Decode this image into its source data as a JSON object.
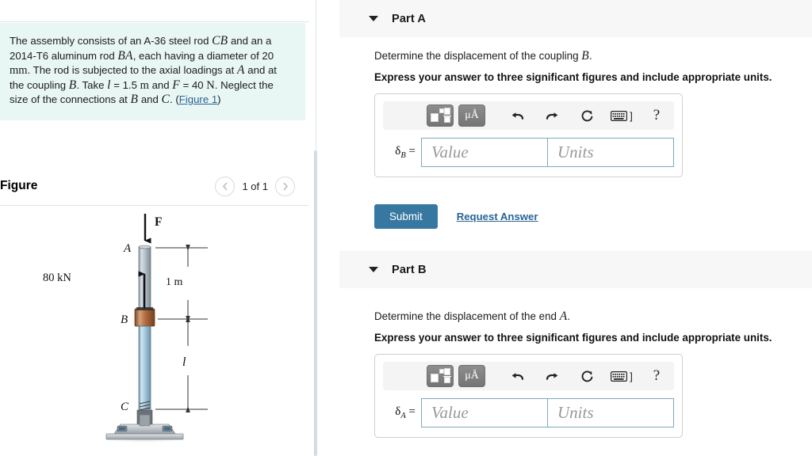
{
  "left": {
    "problem": {
      "segments": [
        {
          "t": "The assembly consists of an A-36 steel rod ",
          "s": "plain"
        },
        {
          "t": "CB",
          "s": "math"
        },
        {
          "t": " and an a 2014-T6 aluminum rod ",
          "s": "plain"
        },
        {
          "t": "BA",
          "s": "math"
        },
        {
          "t": ", each having a diameter of 20 ",
          "s": "plain"
        },
        {
          "t": "mm",
          "s": "mathup"
        },
        {
          "t": ". The rod is subjected to the axial loadings at ",
          "s": "plain"
        },
        {
          "t": "A",
          "s": "math"
        },
        {
          "t": " and at the coupling ",
          "s": "plain"
        },
        {
          "t": "B",
          "s": "math"
        },
        {
          "t": ". Take ",
          "s": "plain"
        },
        {
          "t": "l",
          "s": "math"
        },
        {
          "t": " = 1.5 ",
          "s": "plain"
        },
        {
          "t": "m",
          "s": "mathup"
        },
        {
          "t": " and ",
          "s": "plain"
        },
        {
          "t": "F",
          "s": "math"
        },
        {
          "t": " = 40 ",
          "s": "plain"
        },
        {
          "t": "N",
          "s": "mathup"
        },
        {
          "t": ". Neglect the size of the connections at ",
          "s": "plain"
        },
        {
          "t": "B",
          "s": "math"
        },
        {
          "t": " and ",
          "s": "plain"
        },
        {
          "t": "C",
          "s": "math"
        },
        {
          "t": ". (",
          "s": "plain"
        },
        {
          "t": "Figure 1",
          "s": "link"
        },
        {
          "t": ")",
          "s": "plain"
        }
      ],
      "background_color": "#e8f6f4"
    },
    "figure": {
      "title": "Figure",
      "prev_icon": "chevron-left-icon",
      "next_icon": "chevron-right-icon",
      "counter": "1 of 1",
      "labels": {
        "force": "F",
        "point_a": "A",
        "point_b": "B",
        "point_c": "C",
        "load": "80 kN",
        "dim_top": "1 m",
        "dim_bottom": "l"
      },
      "colors": {
        "aluminum_rod": "#b7c5ce",
        "steel_rod": "#a8cbdd",
        "coupling": "#b8764a",
        "base": "#c3c6c9"
      }
    }
  },
  "right": {
    "parts": [
      {
        "id": "part-a",
        "label": "Part A",
        "caret_icon": "caret-down-icon",
        "prompt_segments": [
          {
            "t": "Determine the displacement of the coupling ",
            "s": "plain"
          },
          {
            "t": "B",
            "s": "math"
          },
          {
            "t": ".",
            "s": "plain"
          }
        ],
        "instruction": "Express your answer to three significant figures and include appropriate units.",
        "answer": {
          "symbol": "δ",
          "subscript": "B",
          "equals": "=",
          "value_placeholder": "Value",
          "units_placeholder": "Units",
          "value": "",
          "units": ""
        },
        "toolbar": {
          "template_icon": "math-template-icon",
          "units_icon": "micro-angstrom-icon",
          "units_label": "μÅ",
          "undo_icon": "undo-icon",
          "redo_icon": "redo-icon",
          "reset_icon": "reset-icon",
          "keyboard_icon": "keyboard-icon",
          "keyboard_bracket": "]",
          "help_icon": "help-icon",
          "help_label": "?"
        },
        "submit_label": "Submit",
        "request_answer_label": "Request Answer",
        "has_actions": true
      },
      {
        "id": "part-b",
        "label": "Part B",
        "caret_icon": "caret-down-icon",
        "prompt_segments": [
          {
            "t": "Determine the displacement of the end ",
            "s": "plain"
          },
          {
            "t": "A",
            "s": "math"
          },
          {
            "t": ".",
            "s": "plain"
          }
        ],
        "instruction": "Express your answer to three significant figures and include appropriate units.",
        "answer": {
          "symbol": "δ",
          "subscript": "A",
          "equals": "=",
          "value_placeholder": "Value",
          "units_placeholder": "Units",
          "value": "",
          "units": ""
        },
        "toolbar": {
          "template_icon": "math-template-icon",
          "units_icon": "micro-angstrom-icon",
          "units_label": "μÅ",
          "undo_icon": "undo-icon",
          "redo_icon": "redo-icon",
          "reset_icon": "reset-icon",
          "keyboard_icon": "keyboard-icon",
          "keyboard_bracket": "]",
          "help_icon": "help-icon",
          "help_label": "?"
        },
        "has_actions": false
      }
    ]
  },
  "colors": {
    "accent": "#3778a0",
    "link": "#2a6496",
    "panel_bg": "#e8f6f4",
    "header_bg": "#f7f7f7",
    "field_border": "#7fa8bf"
  }
}
